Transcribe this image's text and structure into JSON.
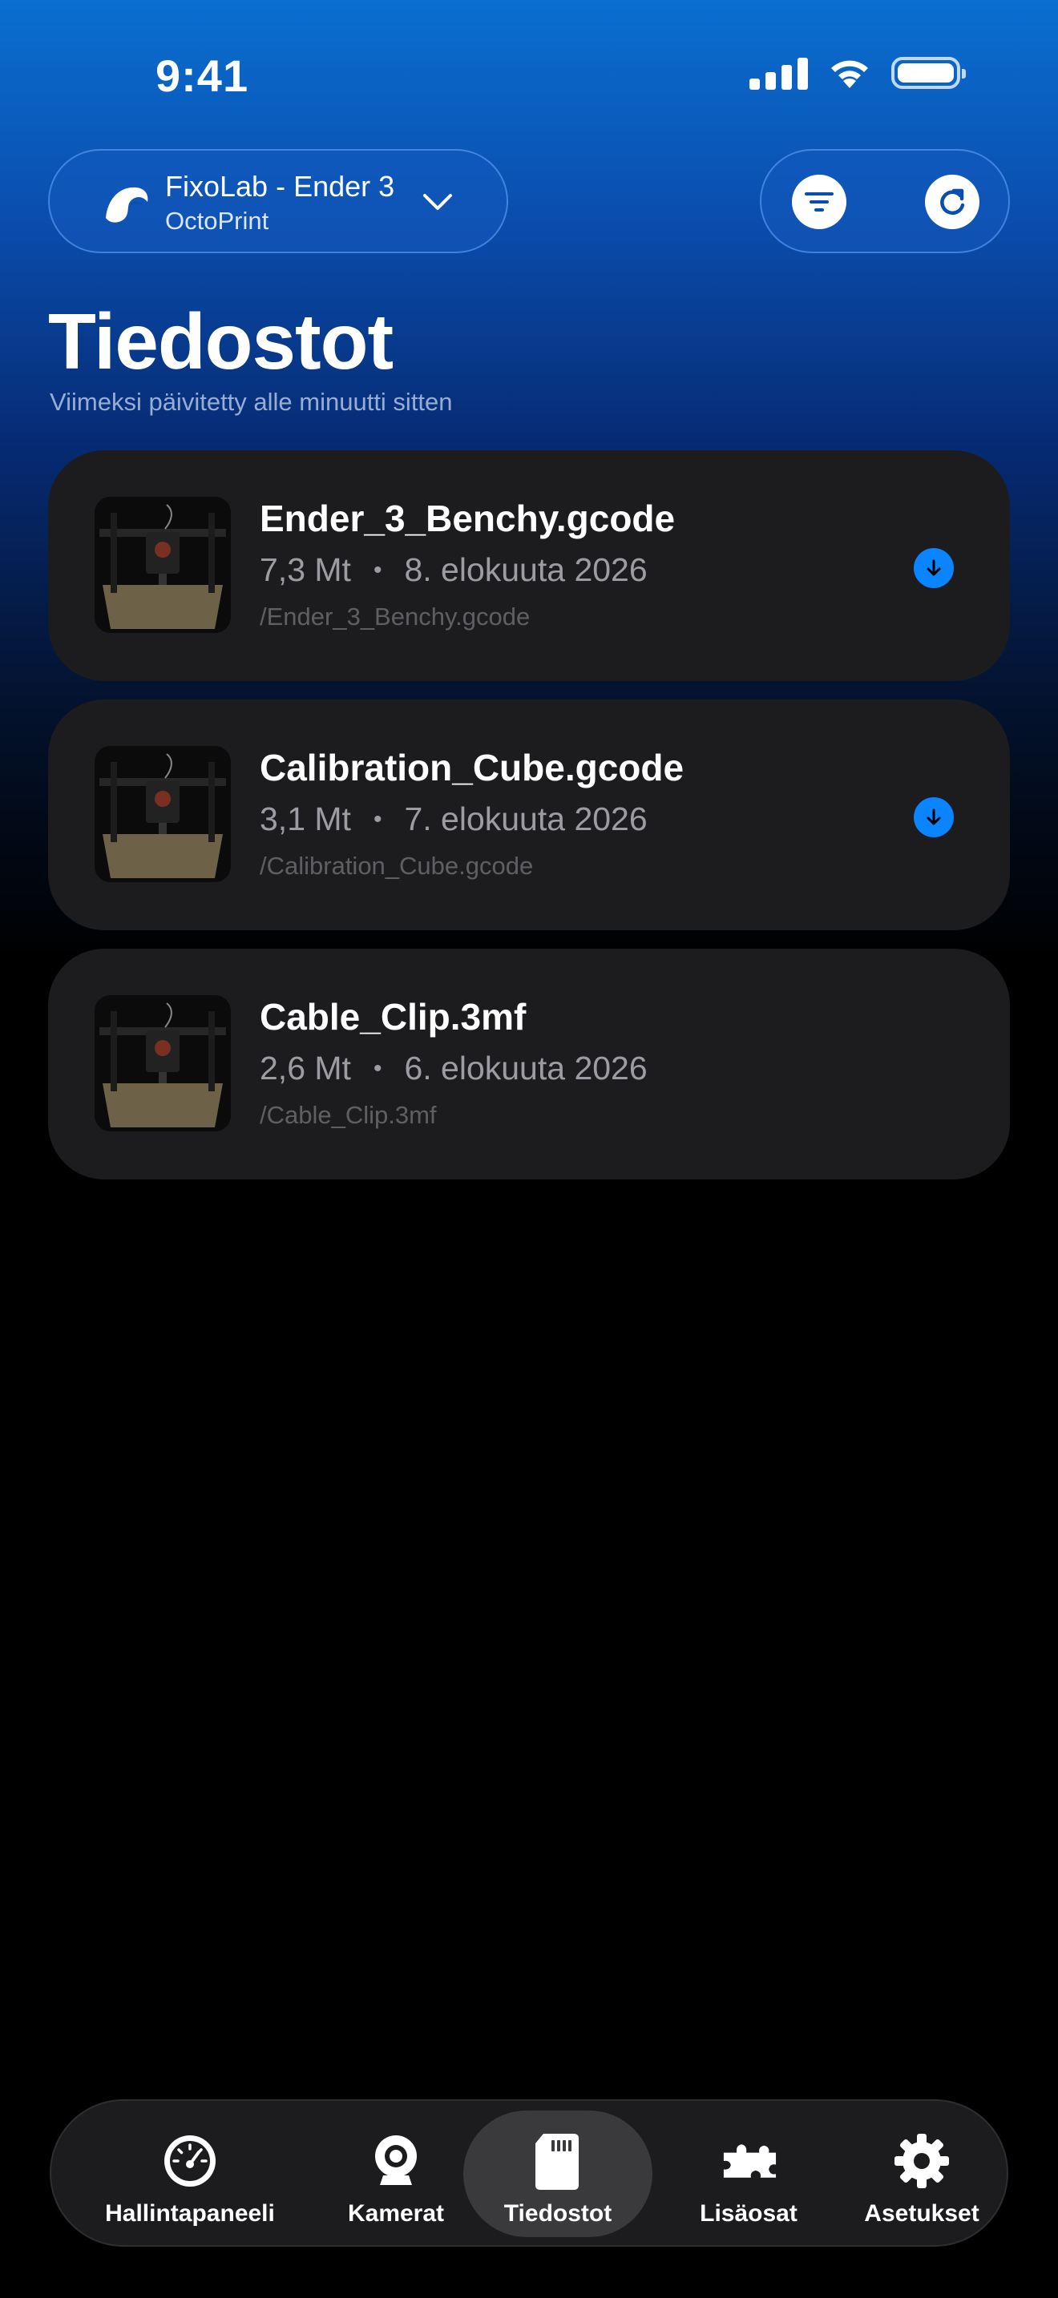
{
  "status_bar": {
    "time": "9:41"
  },
  "printer_selector": {
    "name": "FixoLab - Ender 3",
    "platform": "OctoPrint"
  },
  "page": {
    "title": "Tiedostot",
    "subtitle": "Viimeksi päivitetty alle minuutti sitten"
  },
  "files": [
    {
      "name": "Ender_3_Benchy.gcode",
      "size": "7,3 Mt",
      "date": "8. elokuuta 2026",
      "path": "/Ender_3_Benchy.gcode",
      "downloadable": true
    },
    {
      "name": "Calibration_Cube.gcode",
      "size": "3,1 Mt",
      "date": "7. elokuuta 2026",
      "path": "/Calibration_Cube.gcode",
      "downloadable": true
    },
    {
      "name": "Cable_Clip.3mf",
      "size": "2,6 Mt",
      "date": "6. elokuuta 2026",
      "path": "/Cable_Clip.3mf",
      "downloadable": false
    }
  ],
  "meta_separator": "•",
  "tab_bar": {
    "tabs": [
      {
        "label": "Hallintapaneeli",
        "icon": "gauge-icon",
        "active": false
      },
      {
        "label": "Kamerat",
        "icon": "webcam-icon",
        "active": false
      },
      {
        "label": "Tiedostot",
        "icon": "sd-card-icon",
        "active": true
      },
      {
        "label": "Lisäosat",
        "icon": "puzzle-icon",
        "active": false
      },
      {
        "label": "Asetukset",
        "icon": "gear-icon",
        "active": false
      }
    ]
  },
  "colors": {
    "accent": "#0a84ff",
    "card_background": "#1c1c1e",
    "gradient_top": "#0a6fd0"
  }
}
